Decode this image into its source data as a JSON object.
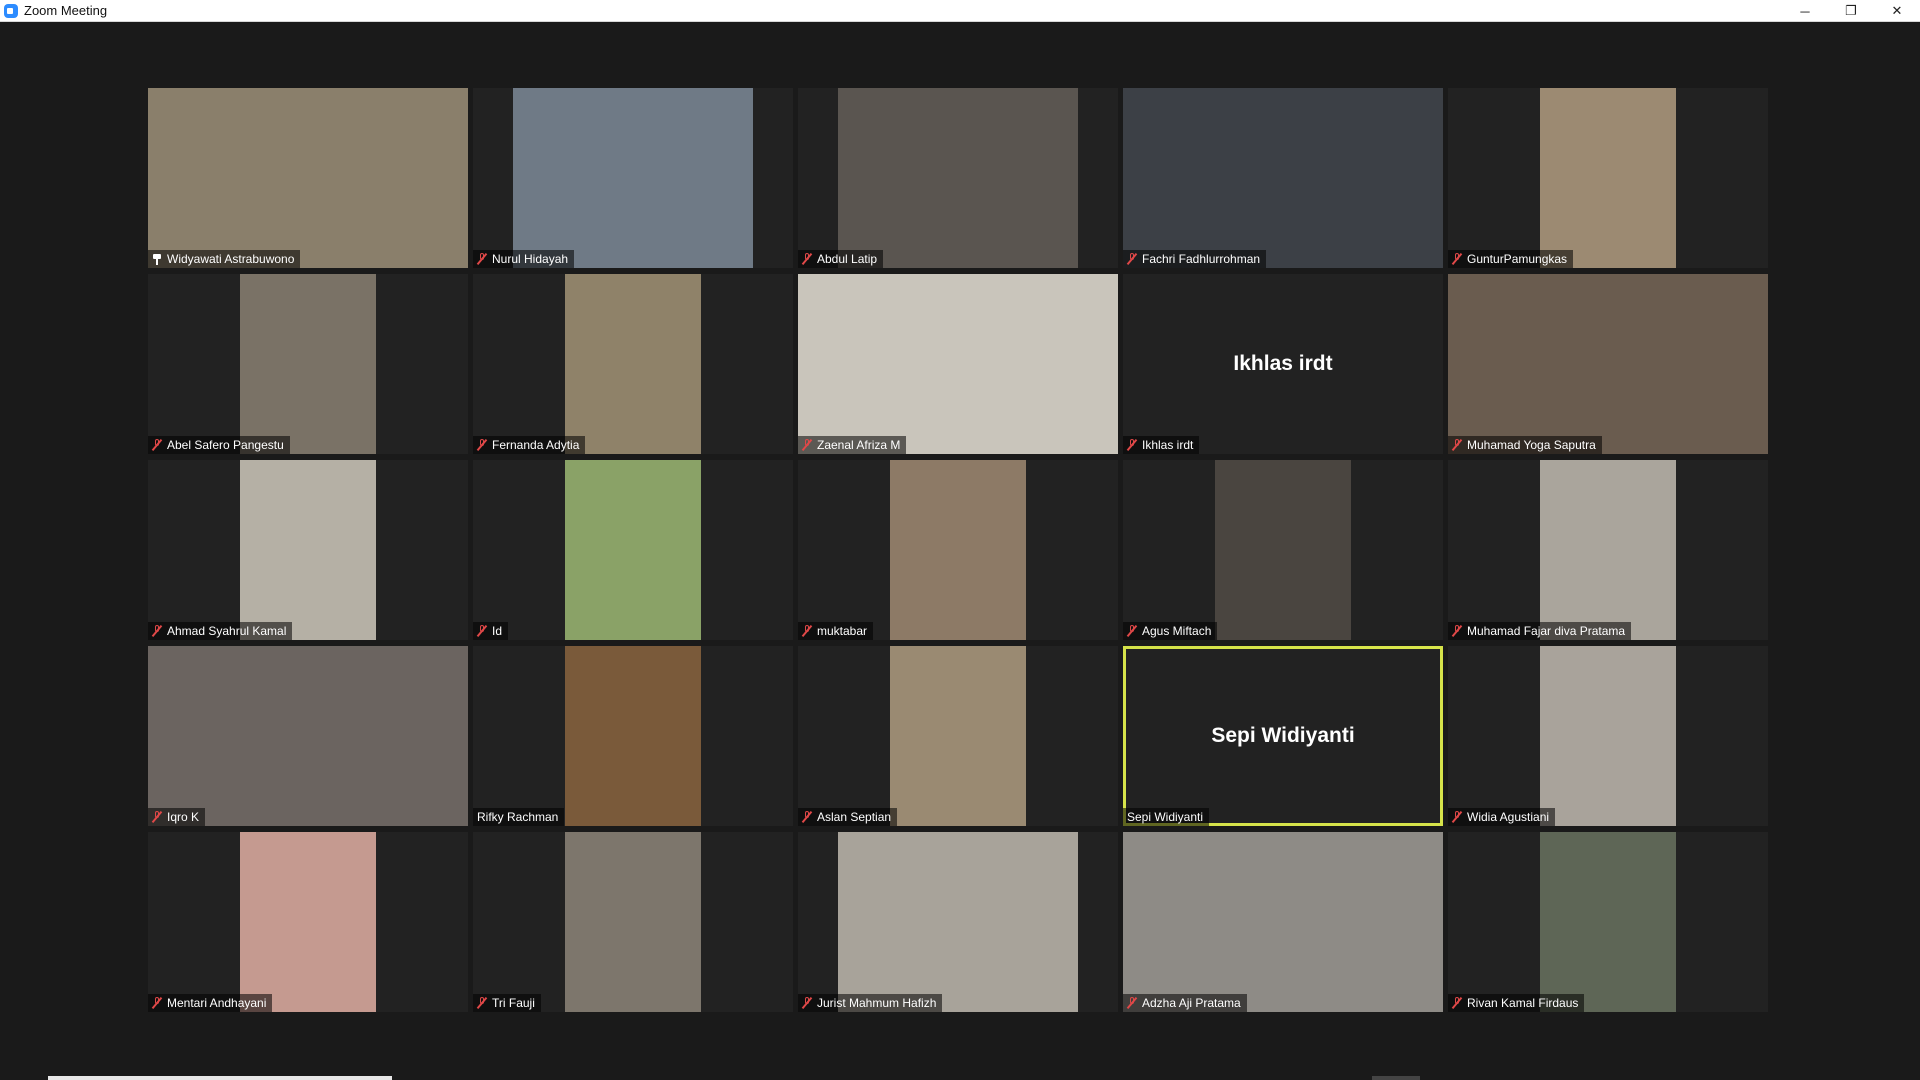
{
  "window": {
    "title": "Zoom Meeting",
    "controls": {
      "minimize": "─",
      "restore": "❐",
      "close": "✕"
    }
  },
  "participants": [
    {
      "name": "Widyawati Astrabuwono",
      "status": "pinned",
      "display": "video",
      "width": "full",
      "bg": "#8a7f6b"
    },
    {
      "name": "Nurul Hidayah",
      "status": "muted",
      "display": "video",
      "width": "mid",
      "bg": "#6f7a86"
    },
    {
      "name": "Abdul Latip",
      "status": "muted",
      "display": "video",
      "width": "mid",
      "bg": "#5a5550"
    },
    {
      "name": "Fachri Fadhlurrohman",
      "status": "muted",
      "display": "video",
      "width": "full",
      "bg": "#3c4046"
    },
    {
      "name": "GunturPamungkas",
      "status": "muted",
      "display": "video",
      "width": "narrow",
      "bg": "#9c8a72"
    },
    {
      "name": "Abel Safero Pangestu",
      "status": "muted",
      "display": "video",
      "width": "narrow",
      "bg": "#7a7266"
    },
    {
      "name": "Fernanda Adytia",
      "status": "muted",
      "display": "video",
      "width": "narrow",
      "bg": "#8f8269"
    },
    {
      "name": "Zaenal Afriza M",
      "status": "muted",
      "display": "video",
      "width": "full",
      "bg": "#c9c5bb"
    },
    {
      "name": "Ikhlas irdt",
      "status": "muted",
      "display": "name-only",
      "center_label": "Ikhlas irdt"
    },
    {
      "name": "Muhamad Yoga Saputra",
      "status": "muted",
      "display": "video",
      "width": "full",
      "bg": "#6a5c4f"
    },
    {
      "name": "Ahmad Syahrul Kamal",
      "status": "muted",
      "display": "video",
      "width": "narrow",
      "bg": "#b5b0a5"
    },
    {
      "name": "Id",
      "status": "muted",
      "display": "video",
      "width": "narrow",
      "bg": "#8aa267"
    },
    {
      "name": "muktabar",
      "status": "muted",
      "display": "video",
      "width": "narrow",
      "bg": "#8d7a66"
    },
    {
      "name": "Agus Miftach",
      "status": "muted",
      "display": "video",
      "width": "narrow",
      "bg": "#4a4540"
    },
    {
      "name": "Muhamad Fajar diva Pratama",
      "status": "muted",
      "display": "video",
      "width": "narrow",
      "bg": "#aaa59c"
    },
    {
      "name": "Iqro K",
      "status": "muted",
      "display": "video",
      "width": "full",
      "bg": "#6b6460"
    },
    {
      "name": "Rifky Rachman",
      "status": "none",
      "display": "video",
      "width": "narrow",
      "bg": "#7a5a3a"
    },
    {
      "name": "Aslan Septian",
      "status": "muted",
      "display": "video",
      "width": "narrow",
      "bg": "#9a8a72"
    },
    {
      "name": "Sepi Widiyanti",
      "status": "active-speaker",
      "display": "name-only",
      "center_label": "Sepi Widiyanti"
    },
    {
      "name": "Widia Agustiani",
      "status": "muted",
      "display": "video",
      "width": "narrow",
      "bg": "#a9a39b"
    },
    {
      "name": "Mentari Andhayani",
      "status": "muted",
      "display": "video",
      "width": "narrow",
      "bg": "#c59a90"
    },
    {
      "name": "Tri Fauji",
      "status": "muted",
      "display": "video",
      "width": "narrow",
      "bg": "#7d766c"
    },
    {
      "name": "Jurist Mahmum Hafizh",
      "status": "muted",
      "display": "video",
      "width": "mid",
      "bg": "#a8a39a"
    },
    {
      "name": "Adzha Aji Pratama",
      "status": "muted",
      "display": "video",
      "width": "full",
      "bg": "#8e8b86"
    },
    {
      "name": "Rivan Kamal Firdaus",
      "status": "muted",
      "display": "video",
      "width": "narrow",
      "bg": "#5e6656"
    }
  ],
  "colors": {
    "background": "#1a1a1a",
    "tile_empty": "#222222",
    "active_speaker_border": "#d6e34a",
    "muted_icon": "#e04848"
  }
}
